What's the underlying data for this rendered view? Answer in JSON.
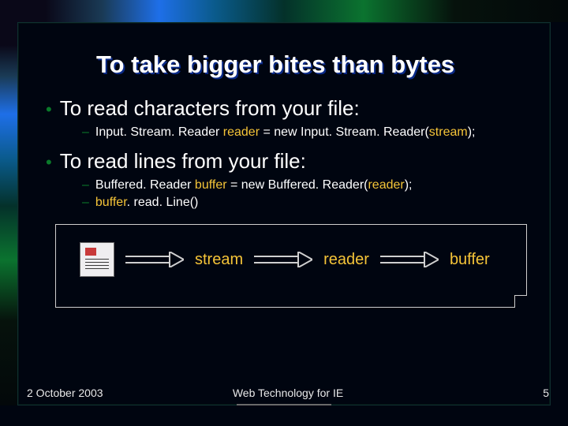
{
  "slide": {
    "title": "To take bigger bites than bytes",
    "bullets": [
      {
        "text": "To read characters from your file:",
        "children": [
          {
            "prefix": "Input. Stream. Reader ",
            "var": "reader",
            "mid": " = new Input. Stream. Reader(",
            "var2": "stream",
            "suffix": "); "
          }
        ]
      },
      {
        "text": "To read lines from your file:",
        "children": [
          {
            "prefix": "Buffered. Reader ",
            "var": "buffer",
            "mid": " = new Buffered. Reader(",
            "var2": "reader",
            "suffix": "); "
          },
          {
            "prefix": "",
            "var": "buffer",
            "mid": ". read. Line()",
            "var2": "",
            "suffix": ""
          }
        ]
      }
    ],
    "flow": {
      "labels": [
        "stream",
        "reader",
        "buffer"
      ]
    },
    "footer": {
      "date": "2 October 2003",
      "course": "Web Technology for IE",
      "page": "5"
    }
  }
}
